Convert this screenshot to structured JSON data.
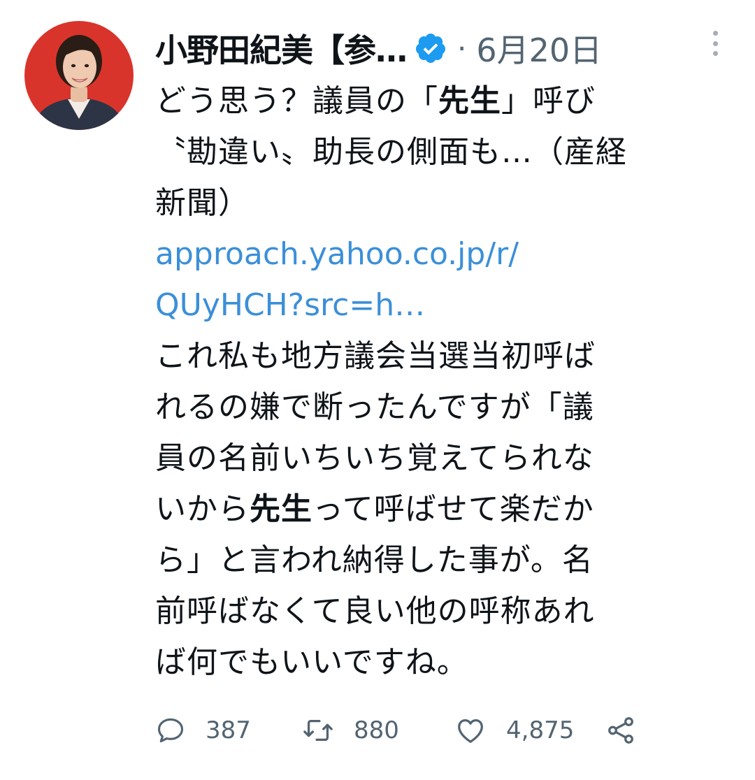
{
  "author": {
    "display_name": "小野田紀美【参…",
    "verified": true,
    "separator": "·",
    "date": "6月20日"
  },
  "tweet": {
    "lines": [
      [
        {
          "t": "どう思う？議員の「"
        },
        {
          "t": "先生",
          "b": true
        },
        {
          "t": "」呼び"
        }
      ],
      [
        {
          "t": "〝勘違い〟助長の側面も…（産経"
        }
      ],
      [
        {
          "t": "新聞）"
        }
      ],
      [
        {
          "t": " approach.yahoo.co.jp/r/",
          "link": true
        }
      ],
      [
        {
          "t": "QUyHCH?src=h…",
          "link": true
        }
      ],
      [
        {
          "t": "これ私も地方議会当選当初呼ば"
        }
      ],
      [
        {
          "t": "れるの嫌で断ったんですが「議"
        }
      ],
      [
        {
          "t": "員の名前いちいち覚えてられな"
        }
      ],
      [
        {
          "t": "いから"
        },
        {
          "t": "先生",
          "b": true
        },
        {
          "t": "って呼ばせて楽だか"
        }
      ],
      [
        {
          "t": "ら」と言われ納得した事が。名"
        }
      ],
      [
        {
          "t": "前呼ばなくて良い他の呼称あれ"
        }
      ],
      [
        {
          "t": "ば何でもいいですね。"
        }
      ]
    ]
  },
  "actions": {
    "replies": "387",
    "retweets": "880",
    "likes": "4,875"
  },
  "icons": {
    "avatar": "profile-photo",
    "verified": "verified-badge-icon",
    "more": "more-vertical-icon",
    "reply": "reply-icon",
    "retweet": "retweet-icon",
    "like": "heart-icon",
    "share": "share-icon"
  },
  "colors": {
    "text": "#0f1419",
    "secondary": "#536471",
    "link": "#3b8fd9",
    "verified": "#1d9bf0",
    "avatar_bg": "#d9342b"
  }
}
